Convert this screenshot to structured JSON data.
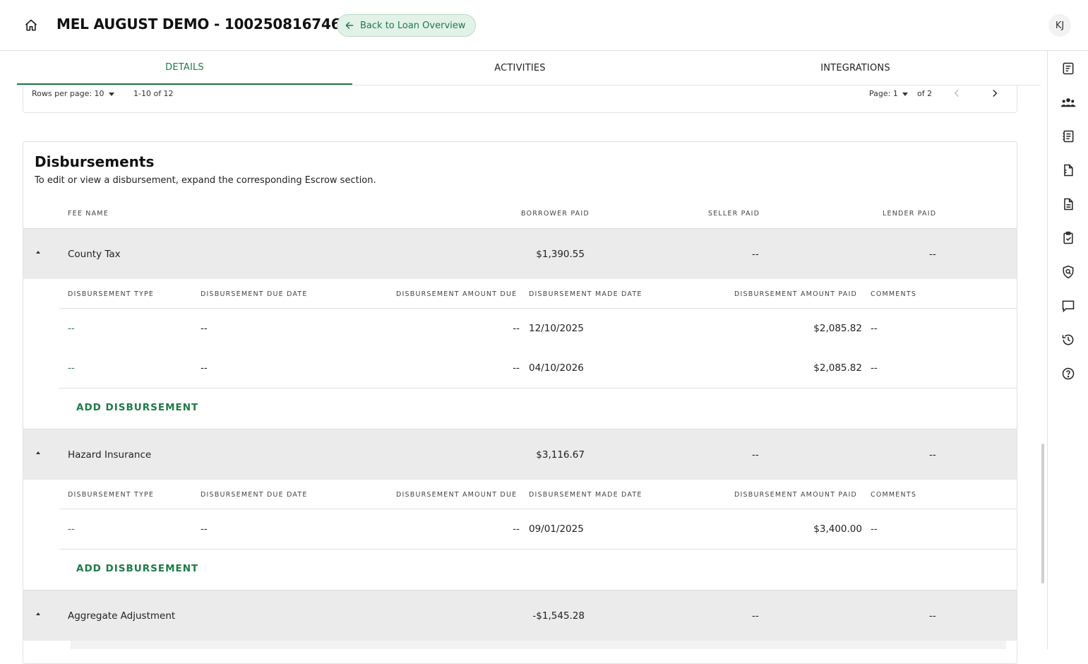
{
  "header": {
    "title": "MEL AUGUST DEMO - 100250816746",
    "back_label": "Back to Loan Overview",
    "avatar_initials": "KJ"
  },
  "tabs": [
    {
      "label": "DETAILS",
      "active": true
    },
    {
      "label": "ACTIVITIES",
      "active": false
    },
    {
      "label": "INTEGRATIONS",
      "active": false
    }
  ],
  "pager": {
    "rows_per_page_label": "Rows per page: 10",
    "range": "1-10 of 12",
    "page_label": "Page: 1",
    "of_pages": "of 2"
  },
  "disbursements": {
    "title": "Disbursements",
    "subtitle": "To edit or view a disbursement, expand the corresponding Escrow section.",
    "columns": {
      "fee_name": "FEE NAME",
      "borrower_paid": "BORROWER PAID",
      "seller_paid": "SELLER PAID",
      "lender_paid": "LENDER PAID"
    },
    "sub_columns": {
      "type": "DISBURSEMENT TYPE",
      "due_date": "DISBURSEMENT DUE DATE",
      "amount_due": "DISBURSEMENT AMOUNT DUE",
      "made_date": "DISBURSEMENT MADE DATE",
      "amount_paid": "DISBURSEMENT AMOUNT PAID",
      "comments": "COMMENTS"
    },
    "add_label": "ADD DISBURSEMENT",
    "fees": [
      {
        "name": "County Tax",
        "borrower_paid": "$1,390.55",
        "seller_paid": "--",
        "lender_paid": "--",
        "rows": [
          {
            "type": "--",
            "due_date": "--",
            "amount_due": "--",
            "made_date": "12/10/2025",
            "amount_paid": "$2,085.82",
            "comments": "--"
          },
          {
            "type": "--",
            "due_date": "--",
            "amount_due": "--",
            "made_date": "04/10/2026",
            "amount_paid": "$2,085.82",
            "comments": "--"
          }
        ]
      },
      {
        "name": "Hazard Insurance",
        "borrower_paid": "$3,116.67",
        "seller_paid": "--",
        "lender_paid": "--",
        "rows": [
          {
            "type": "--",
            "due_date": "--",
            "amount_due": "--",
            "made_date": "09/01/2025",
            "amount_paid": "$3,400.00",
            "comments": "--"
          }
        ]
      },
      {
        "name": "Aggregate Adjustment",
        "borrower_paid": "-$1,545.28",
        "seller_paid": "--",
        "lender_paid": "--",
        "rows": []
      }
    ]
  },
  "icons": {
    "home": "home-icon",
    "back": "arrow-left-icon",
    "rail": [
      "summary-icon",
      "people-icon",
      "ledger-icon",
      "document-split-icon",
      "document-icon",
      "clipboard-check-icon",
      "shield-search-icon",
      "chat-icon",
      "history-icon",
      "help-icon"
    ]
  },
  "colors": {
    "accent": "#1e7a47",
    "accent_bg": "#e3f2e9",
    "fee_row_bg": "#ebebeb"
  }
}
